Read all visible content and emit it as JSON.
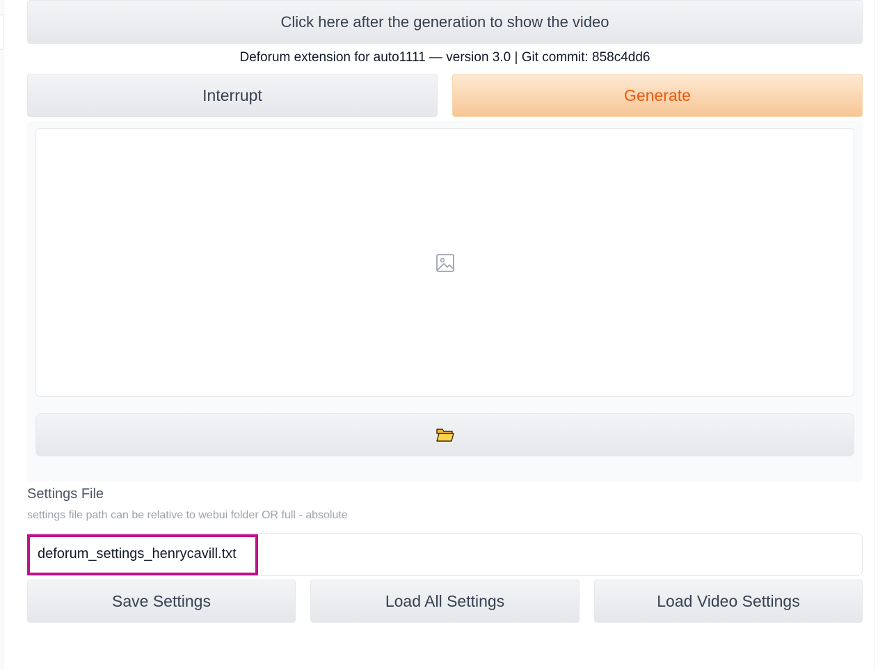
{
  "header": {
    "show_video_label": "Click here after the generation to show the video",
    "version_text": "Deforum extension for auto1111 — version 3.0 | Git commit: 858c4dd6"
  },
  "actions": {
    "interrupt_label": "Interrupt",
    "generate_label": "Generate"
  },
  "gallery": {
    "placeholder_icon": "image-icon",
    "open_folder_icon": "folder-icon"
  },
  "settings": {
    "label": "Settings File",
    "hint": "settings file path can be relative to webui folder OR full - absolute",
    "path_value": "deforum_settings_henrycavill.txt",
    "save_label": "Save Settings",
    "load_all_label": "Load All Settings",
    "load_video_label": "Load Video Settings"
  },
  "colors": {
    "generate_text": "#ea580c",
    "highlight_border": "#c0118a"
  }
}
